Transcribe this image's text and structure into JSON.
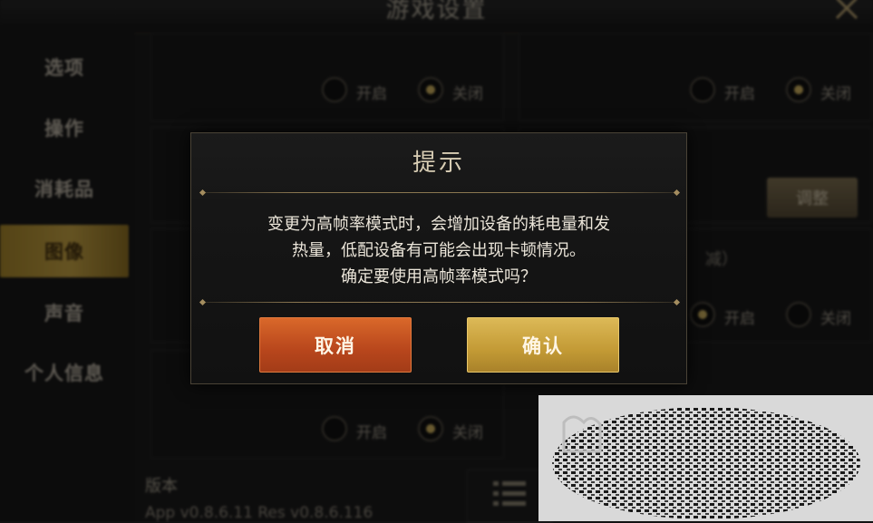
{
  "screen": {
    "title": "游戏设置"
  },
  "sidebar": {
    "items": [
      {
        "label": "选项"
      },
      {
        "label": "操作"
      },
      {
        "label": "消耗品"
      },
      {
        "label": "图像"
      },
      {
        "label": "声音"
      },
      {
        "label": "个人信息"
      }
    ],
    "active_index": 3
  },
  "settings": {
    "toggle_on_label": "开启",
    "toggle_off_label": "关闭",
    "adjust_label": "调整",
    "version_label": "版本",
    "version_text": "App v0.8.6.11 Res v0.8.6.116",
    "partial_label_right": "减）"
  },
  "dialog": {
    "title": "提示",
    "message_lines": [
      "变更为高帧率模式时，会增加设备的耗电量和发",
      "热量，低配设备有可能会出现卡顿情况。",
      "确定要使用高帧率模式吗？"
    ],
    "cancel_label": "取消",
    "confirm_label": "确认"
  },
  "colors": {
    "cancel_button": "#c1501f",
    "confirm_button": "#c9a23e",
    "active_sidebar": "#d1ab45"
  }
}
